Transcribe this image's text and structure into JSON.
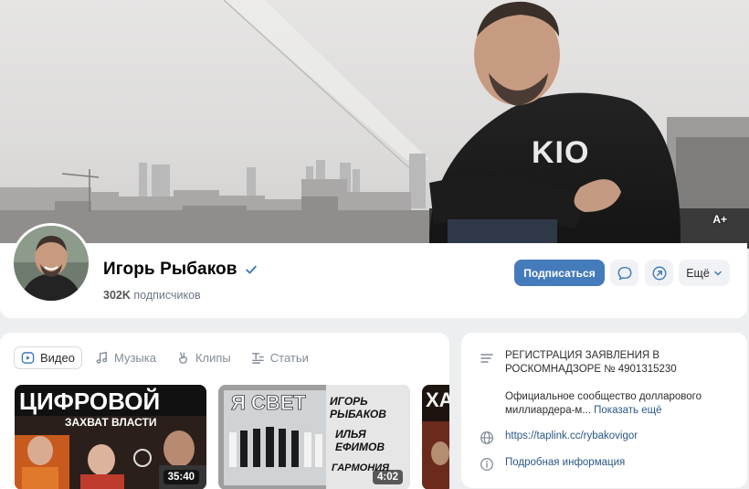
{
  "cover": {
    "font_size_badge": "A+"
  },
  "profile": {
    "name": "Игорь Рыбаков",
    "verified": true,
    "subscribers_count": "302K",
    "subscribers_label": "подписчиков",
    "subscribe_button": "Подписаться",
    "more_button": "Ещё",
    "colors": {
      "primary_button": "#447bba",
      "secondary_button": "#f0f2f5",
      "verified": "#447bba"
    }
  },
  "media": {
    "tabs": [
      {
        "label": "Видео",
        "icon": "video-icon",
        "active": true
      },
      {
        "label": "Музыка",
        "icon": "music-note-icon",
        "active": false
      },
      {
        "label": "Клипы",
        "icon": "clips-icon",
        "active": false
      },
      {
        "label": "Статьи",
        "icon": "articles-icon",
        "active": false
      }
    ],
    "videos": [
      {
        "duration": "35:40",
        "title_line1": "ЦИФРОВОЙ",
        "title_line2": "ЗАХВАТ ВЛАСТИ"
      },
      {
        "duration": "4:02",
        "title_left": "Я СВЕТ",
        "title_right": [
          "ИГОРЬ",
          "РЫБАКОВ",
          "ИЛЬЯ",
          "ЕФИМОВ",
          "ГАРМОНИЯ"
        ]
      },
      {
        "title_partial": "ХА"
      }
    ]
  },
  "info": {
    "status": "РЕГИСТРАЦИЯ ЗАЯВЛЕНИЯ В РОСКОМНАДЗОРЕ № 4901315230",
    "description": "Официальное сообщество долларового миллиардера-м...",
    "show_more": "Показать ещё",
    "website": "https://taplink.cc/rybakovigor",
    "details": "Подробная информация"
  }
}
